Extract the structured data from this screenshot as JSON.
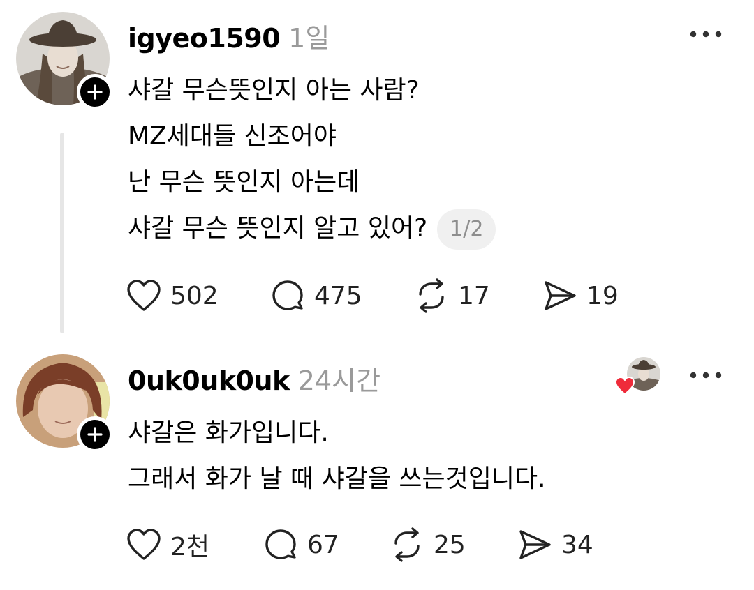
{
  "posts": [
    {
      "username": "igyeo1590",
      "time": "1일",
      "body_lines": [
        "샤갈 무슨뜻인지 아는 사람?",
        "MZ세대들 신조어야",
        "난 무슨 뜻인지 아는데",
        "샤갈 무슨 뜻인지 알고 있어?"
      ],
      "page_indicator": "1/2",
      "likes": "502",
      "replies": "475",
      "reposts": "17",
      "shares": "19"
    },
    {
      "username": "0uk0uk0uk",
      "time": "24시간",
      "body_lines": [
        "샤갈은 화가입니다.",
        "그래서 화가 날 때 샤갈을 쓰는것입니다."
      ],
      "likes": "2천",
      "replies": "67",
      "reposts": "25",
      "shares": "34"
    }
  ],
  "colors": {
    "text": "#000000",
    "muted": "#9a9a9a",
    "thread_line": "#e6e6e6",
    "heart_liked": "#ef2b3a"
  },
  "icons": [
    "heart-icon",
    "comment-icon",
    "repost-icon",
    "share-icon",
    "more-icon",
    "plus-icon"
  ]
}
